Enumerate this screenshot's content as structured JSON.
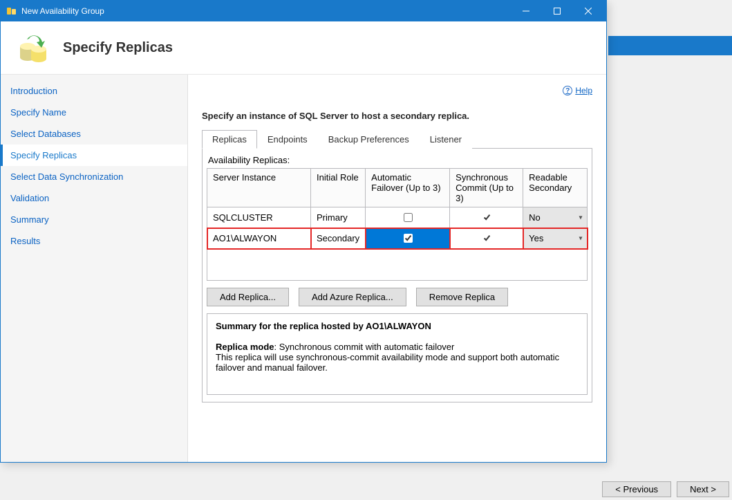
{
  "window": {
    "title": "New Availability Group"
  },
  "header": {
    "title": "Specify Replicas"
  },
  "sidebar": {
    "items": [
      {
        "label": "Introduction",
        "active": false
      },
      {
        "label": "Specify Name",
        "active": false
      },
      {
        "label": "Select Databases",
        "active": false
      },
      {
        "label": "Specify Replicas",
        "active": true
      },
      {
        "label": "Select Data Synchronization",
        "active": false
      },
      {
        "label": "Validation",
        "active": false
      },
      {
        "label": "Summary",
        "active": false
      },
      {
        "label": "Results",
        "active": false
      }
    ]
  },
  "help": {
    "label": "Help"
  },
  "instruction": "Specify an instance of SQL Server to host a secondary replica.",
  "tabs": {
    "items": [
      {
        "label": "Replicas",
        "active": true
      },
      {
        "label": "Endpoints",
        "active": false
      },
      {
        "label": "Backup Preferences",
        "active": false
      },
      {
        "label": "Listener",
        "active": false
      }
    ]
  },
  "grid": {
    "label": "Availability Replicas:",
    "columns": {
      "server": "Server Instance",
      "role": "Initial Role",
      "autofailover": "Automatic Failover (Up to 3)",
      "synccommit": "Synchronous Commit (Up to 3)",
      "readable": "Readable Secondary"
    },
    "rows": [
      {
        "server": "SQLCLUSTER",
        "role": "Primary",
        "auto": false,
        "auto_selected": false,
        "sync": true,
        "readable": "No",
        "highlight": false
      },
      {
        "server": "AO1\\ALWAYON",
        "role": "Secondary",
        "auto": true,
        "auto_selected": true,
        "sync": true,
        "readable": "Yes",
        "highlight": true
      }
    ]
  },
  "buttons": {
    "add": "Add Replica...",
    "azure": "Add Azure Replica...",
    "remove": "Remove Replica"
  },
  "summary": {
    "title_prefix": "Summary for the replica hosted by ",
    "title_server": "AO1\\ALWAYON",
    "mode_label": "Replica mode",
    "mode_separator": ": ",
    "mode_value": "Synchronous commit with automatic failover",
    "desc": "This replica will use synchronous-commit availability mode and support both automatic failover and manual failover."
  },
  "bg": {
    "previous": "< Previous",
    "next": "Next >"
  }
}
